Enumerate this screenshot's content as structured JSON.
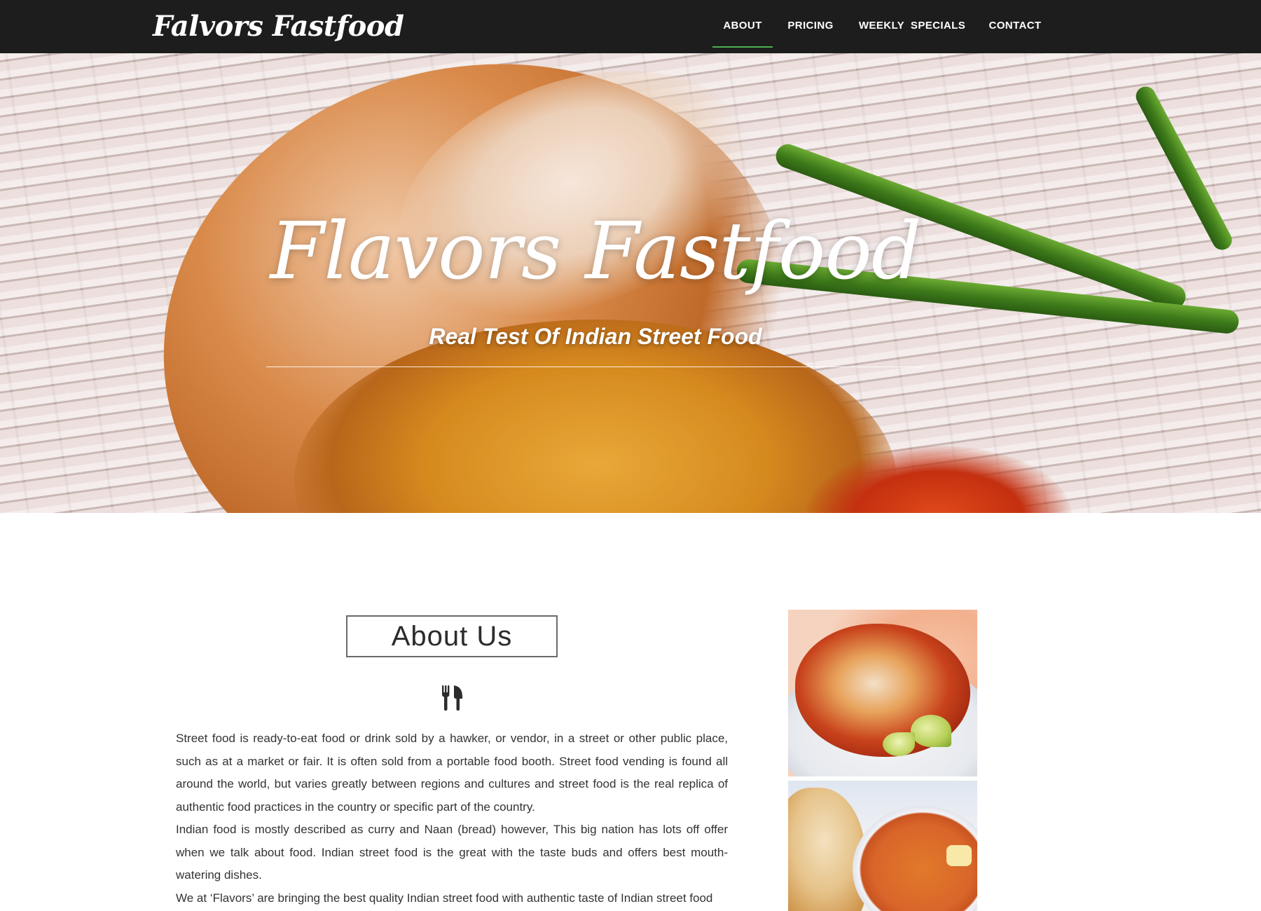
{
  "navbar": {
    "brand": "Falvors Fastfood",
    "items": [
      {
        "label": "ABOUT",
        "active": true
      },
      {
        "label": "PRICING",
        "active": false
      },
      {
        "label": "WEEKLY  SPECIALS",
        "active": false
      },
      {
        "label": "CONTACT",
        "active": false
      }
    ],
    "accent_color": "#4caf50"
  },
  "hero": {
    "title": "Flavors Fastfood",
    "subtitle": "Real Test Of Indian Street Food"
  },
  "about": {
    "heading": "About Us",
    "icon": "utensils-icon",
    "paragraphs": [
      "Street food is ready-to-eat food or drink sold by a hawker, or vendor, in a street or other public place, such as at a market or fair. It is often sold from a portable food booth. Street food vending is found all around the world, but varies greatly between regions and cultures and street food is the real replica of authentic food practices in the country or specific part of the country.",
      "Indian food is mostly described as curry and Naan (bread) however, This big nation has lots off offer when we talk about food. Indian street food is the great with the taste buds and offers best mouth-watering dishes.",
      "We at ‘Flavors’ are bringing the best quality Indian street food with authentic taste of Indian street food"
    ]
  }
}
